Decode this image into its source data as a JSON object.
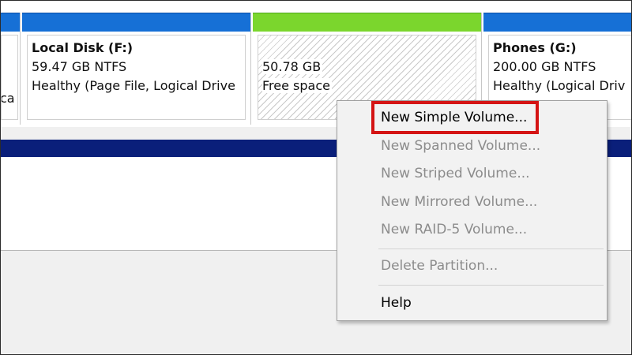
{
  "partitions": [
    {
      "id": "left-cut",
      "name": "",
      "line2": "",
      "line3": "ca",
      "color": "#1670d6"
    },
    {
      "id": "local-disk-f",
      "name": "Local Disk  (F:)",
      "line2": "59.47 GB NTFS",
      "line3": "Healthy (Page File, Logical Drive",
      "color": "#1670d6"
    },
    {
      "id": "free-space",
      "name": "",
      "line2": "50.78 GB",
      "line3": "Free space",
      "color": "#7bd62d"
    },
    {
      "id": "phones-g",
      "name": "Phones  (G:)",
      "line2": "200.00 GB NTFS",
      "line3": "Healthy (Logical Driv",
      "color": "#1670d6"
    }
  ],
  "context_menu": {
    "items": [
      {
        "label": "New Simple Volume...",
        "enabled": true,
        "highlighted": true
      },
      {
        "label": "New Spanned Volume...",
        "enabled": false
      },
      {
        "label": "New Striped Volume...",
        "enabled": false
      },
      {
        "label": "New Mirrored Volume...",
        "enabled": false
      },
      {
        "label": "New RAID-5 Volume...",
        "enabled": false
      },
      {
        "label": "Delete Partition...",
        "enabled": false
      },
      {
        "label": "Help",
        "enabled": true
      }
    ],
    "highlight_color": "#d41414"
  },
  "colors": {
    "primary_partition_bar": "#1670d6",
    "free_space_bar": "#7bd62d",
    "disk_bar_dark": "#0a1f7a"
  }
}
